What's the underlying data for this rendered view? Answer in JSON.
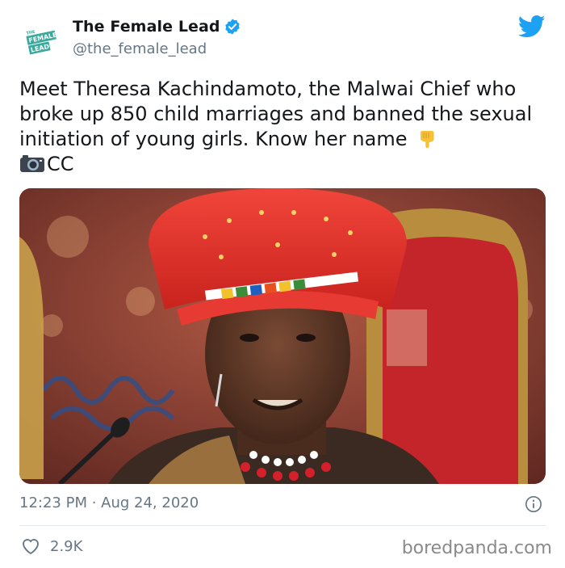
{
  "account": {
    "display_name": "The Female Lead",
    "handle": "@the_female_lead",
    "logo_text": {
      "line1": "THE",
      "line2": "FEMALE",
      "line3": "LEAD"
    }
  },
  "tweet": {
    "text_main": "Meet Theresa Kachindamoto, the Malwai Chief who broke up 850 child marriages and banned the sexual initiation of young girls. Know her name",
    "text_credit": "CC",
    "timestamp": "12:23 PM · Aug 24, 2020",
    "like_count": "2.9K"
  },
  "icons": {
    "verified": "verified-badge-icon",
    "twitter": "twitter-bird-icon",
    "pointing_down": "backhand-index-pointing-down-emoji",
    "camera": "camera-emoji",
    "info": "info-icon",
    "heart": "heart-icon"
  },
  "colors": {
    "twitter_blue": "#1da1f2",
    "text": "#14171a",
    "muted": "#657786",
    "logo_teal": "#3aa89a"
  },
  "watermark": "boredpanda.com"
}
